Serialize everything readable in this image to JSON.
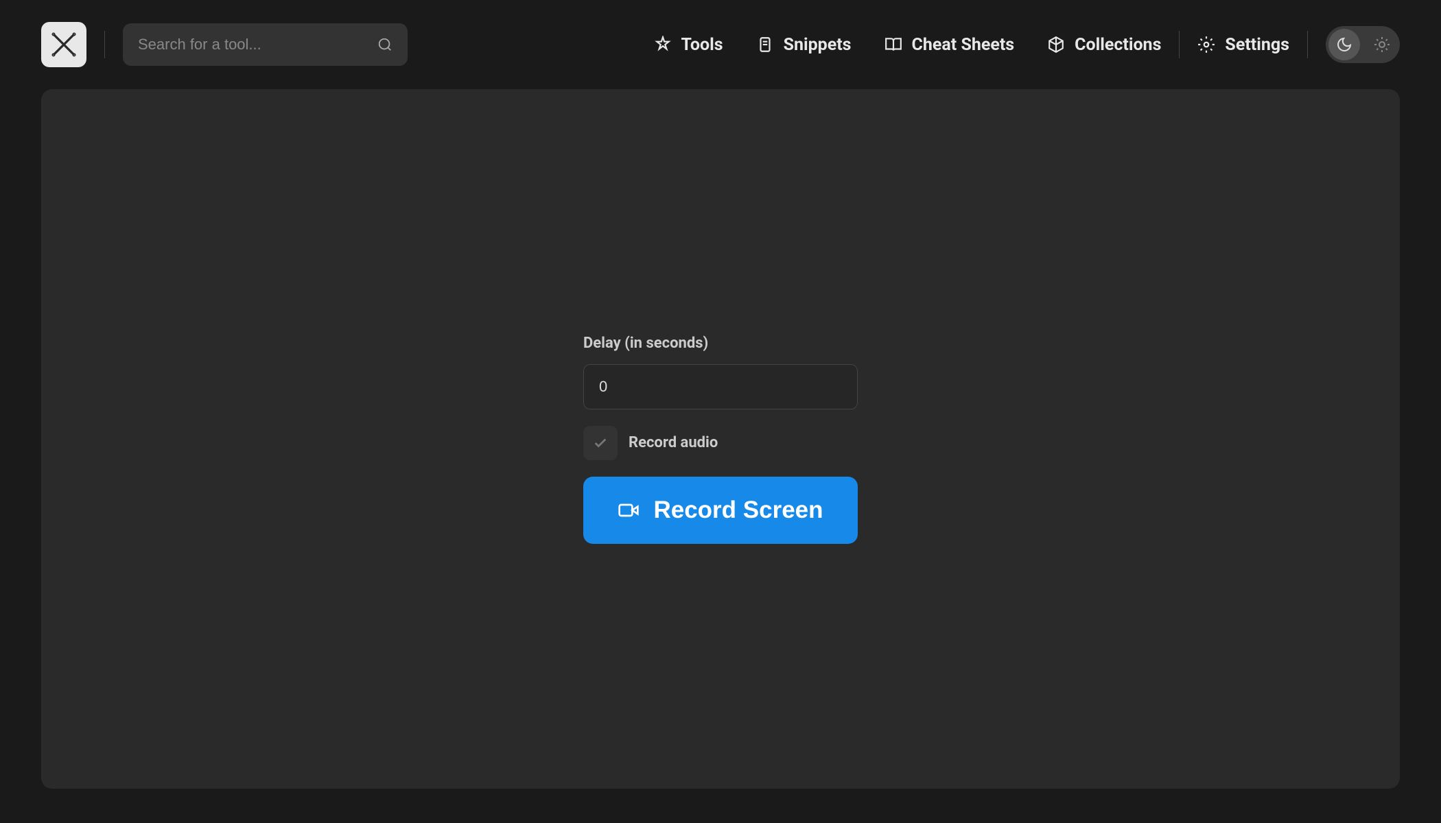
{
  "search": {
    "placeholder": "Search for a tool..."
  },
  "nav": {
    "tools": "Tools",
    "snippets": "Snippets",
    "cheatSheets": "Cheat Sheets",
    "collections": "Collections",
    "settings": "Settings"
  },
  "form": {
    "delayLabel": "Delay (in seconds)",
    "delayValue": "0",
    "recordAudioLabel": "Record audio",
    "recordButtonLabel": "Record Screen"
  },
  "colors": {
    "accent": "#1789e8",
    "background": "#1a1a1a",
    "panel": "#2a2a2a"
  }
}
